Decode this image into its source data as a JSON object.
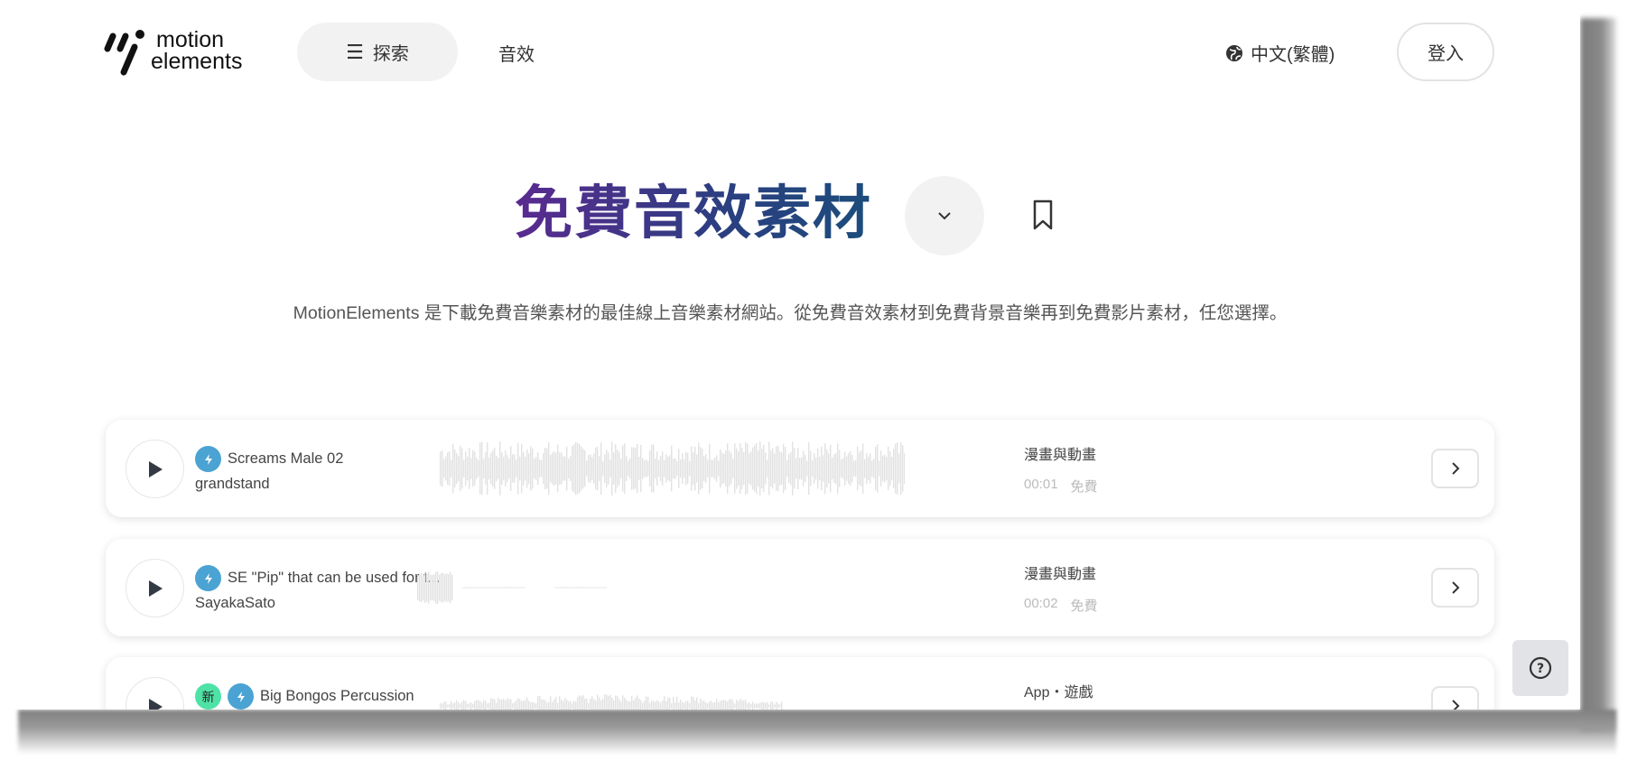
{
  "header": {
    "logo_line1": "motion",
    "logo_line2": "elements",
    "explore_label": "探索",
    "sound_effects_label": "音效",
    "language_label": "中文(繁體)",
    "login_label": "登入"
  },
  "hero": {
    "title": "免費音效素材",
    "description": "MotionElements 是下載免費音樂素材的最佳線上音樂素材網站。從免費音效素材到免費背景音樂再到免費影片素材，任您選擇。"
  },
  "tracks": [
    {
      "title": "Screams Male 02",
      "author": "grandstand",
      "category": "漫畫與動畫",
      "duration": "00:01",
      "price": "免費",
      "is_new": false
    },
    {
      "title": "SE \"Pip\" that can be used for t...",
      "author": "SayakaSato",
      "category": "漫畫與動畫",
      "duration": "00:02",
      "price": "免費",
      "is_new": false
    },
    {
      "title": "Big Bongos Percussion",
      "author": "",
      "category": "App・遊戲",
      "duration": "",
      "price": "",
      "is_new": true,
      "new_label": "新"
    }
  ],
  "colors": {
    "title_start": "#5a2a90",
    "title_end": "#1c4d7c",
    "bolt": "#4aa3d3",
    "new_badge": "#4ee2a6"
  }
}
